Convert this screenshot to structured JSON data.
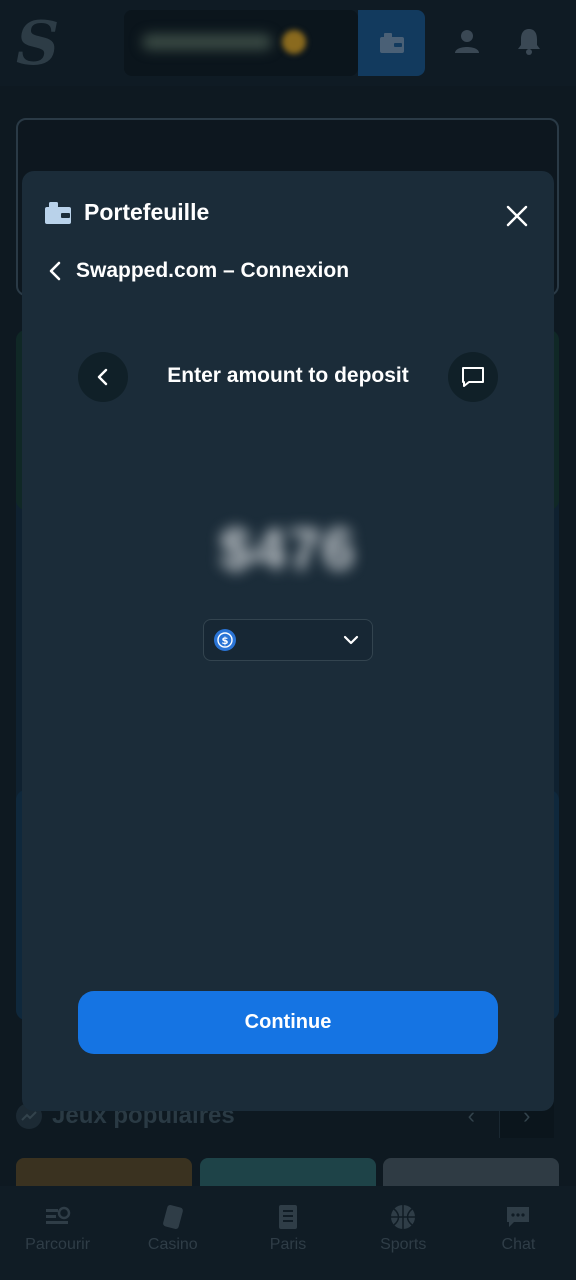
{
  "header": {
    "logo_letter": "S",
    "balance_hidden": "••••••••",
    "icons": [
      "wallet-icon",
      "user-icon",
      "bell-icon"
    ]
  },
  "popular": {
    "title": "Jeux populaires",
    "prev": "‹",
    "next": "›"
  },
  "bottom_nav": [
    {
      "label": "Parcourir",
      "icon": "browse-icon"
    },
    {
      "label": "Casino",
      "icon": "cards-icon"
    },
    {
      "label": "Paris",
      "icon": "betslip-icon"
    },
    {
      "label": "Sports",
      "icon": "basketball-icon"
    },
    {
      "label": "Chat",
      "icon": "chat-icon"
    }
  ],
  "modal": {
    "title": "Portefeuille",
    "subtitle": "Swapped.com – Connexion",
    "step_title": "Enter amount to deposit",
    "amount": "$476",
    "currency": {
      "icon": "usdc-icon",
      "value": ""
    },
    "continue_label": "Continue"
  },
  "colors": {
    "accent": "#1574e3",
    "modal_bg": "#1b2c39",
    "page_bg": "#0e1921"
  }
}
